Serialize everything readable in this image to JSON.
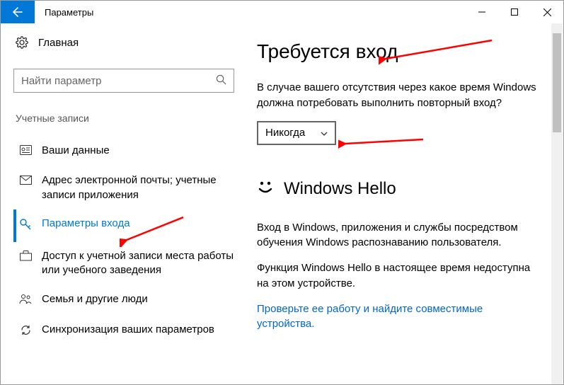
{
  "window": {
    "title": "Параметры"
  },
  "home": {
    "label": "Главная"
  },
  "search": {
    "placeholder": "Найти параметр"
  },
  "group": {
    "title": "Учетные записи"
  },
  "nav": {
    "items": [
      {
        "label": "Ваши данные"
      },
      {
        "label": "Адрес электронной почты; учетные записи приложения"
      },
      {
        "label": "Параметры входа"
      },
      {
        "label": "Доступ к учетной записи места работы или учебного заведения"
      },
      {
        "label": "Семья и другие люди"
      },
      {
        "label": "Синхронизация ваших параметров"
      }
    ]
  },
  "signin": {
    "title": "Требуется вход",
    "question": "В случае вашего отсутствия через какое время Windows должна потребовать выполнить повторный вход?",
    "dropdown_value": "Никогда"
  },
  "hello": {
    "title": "Windows Hello",
    "desc": "Вход в Windows, приложения и службы посредством обучения Windows распознаванию пользователя.",
    "unavail": "Функция Windows Hello в настоящее время недоступна на этом устройстве.",
    "link": "Проверьте ее работу и найдите совместимые устройства."
  }
}
